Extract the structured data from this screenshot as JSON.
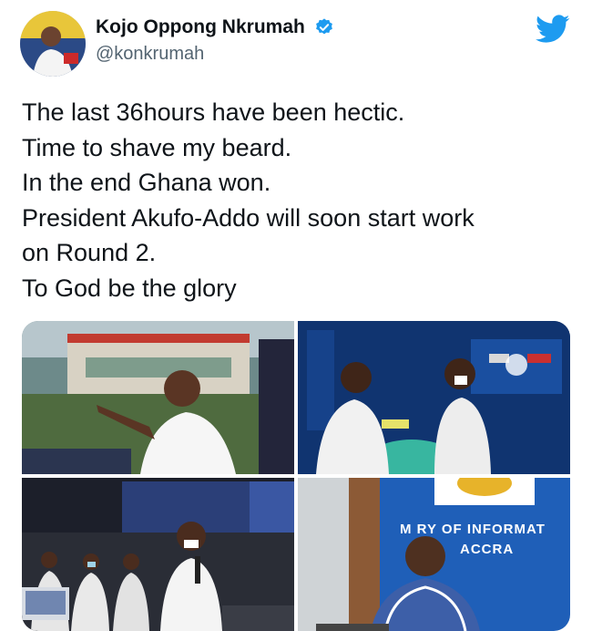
{
  "author": {
    "display_name": "Kojo Oppong Nkrumah",
    "handle": "@konkrumah",
    "verified": true,
    "avatar_icon": "avatar-photo",
    "brand_icon": "twitter-bird-icon",
    "brand_color": "#1d9bf0"
  },
  "tweet": {
    "lines": [
      "The last 36hours have been hectic.",
      "Time to shave my beard.",
      "In the end Ghana won.",
      "President Akufo-Addo will soon start work",
      "on Round 2.",
      "To God be the glory"
    ]
  },
  "media": {
    "photos": [
      {
        "kind": "man-pointing-in-studio"
      },
      {
        "kind": "two-men-at-election-screens"
      },
      {
        "kind": "man-speaking-at-microphone-in-control-room"
      },
      {
        "kind": "man-at-ministry-of-information"
      }
    ],
    "ministry_sign_line1": "M  RY OF INFORMAT",
    "ministry_sign_line2": "ACCRA"
  }
}
